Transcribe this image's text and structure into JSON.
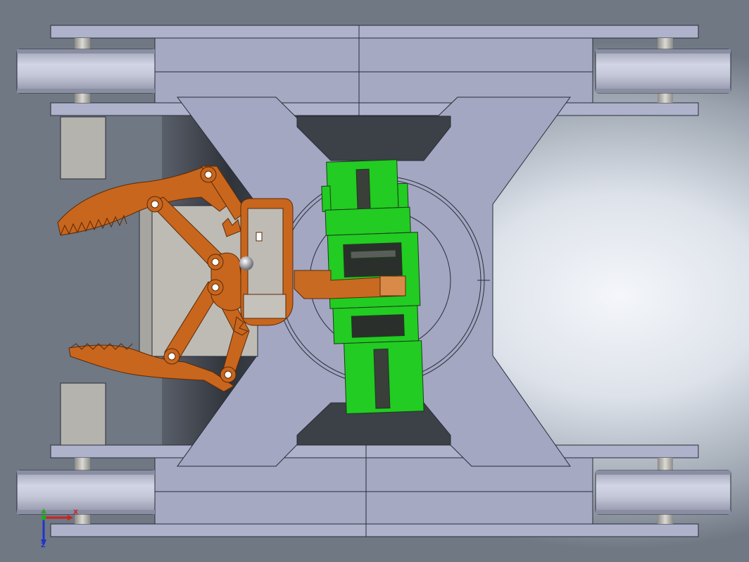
{
  "viewport": {
    "view": "top"
  },
  "triad": {
    "x_label": "X",
    "z_label": "Z"
  },
  "colors": {
    "chassis": "#a5a9c2",
    "chassis_edge": "#2a2d3a",
    "wheel": "#bcc0d3",
    "gripper": "#c8661e",
    "mount": "#22cc22",
    "block": "#b5b3ad",
    "cavity": "#3c4047"
  }
}
